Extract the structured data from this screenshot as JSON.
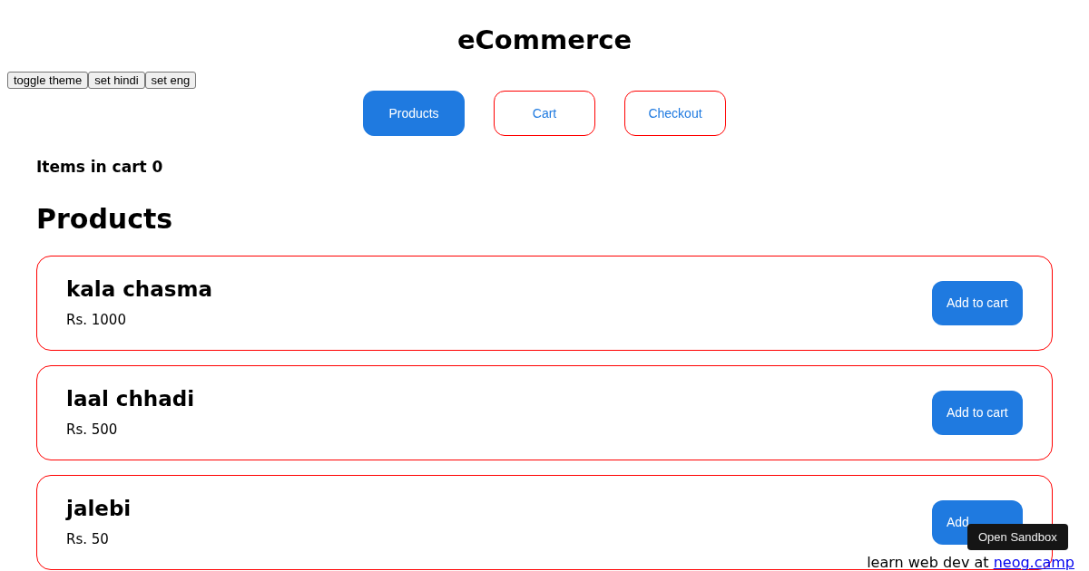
{
  "title": "eCommerce",
  "utility_buttons": [
    "toggle theme",
    "set hindi",
    "set eng"
  ],
  "tabs": [
    {
      "label": "Products",
      "selected": true
    },
    {
      "label": "Cart",
      "selected": false
    },
    {
      "label": "Checkout",
      "selected": false
    }
  ],
  "cart_count": "Items in cart 0",
  "heading": "Products",
  "products": [
    {
      "name": "kala chasma",
      "price": "Rs. 1000",
      "button": "Add to cart"
    },
    {
      "name": "laal chhadi",
      "price": "Rs. 500",
      "button": "Add to cart"
    },
    {
      "name": "jalebi",
      "price": "Rs. 50",
      "button": "Add"
    }
  ],
  "sandbox_button": "Open Sandbox",
  "footer": {
    "text": "learn web dev at",
    "link": "neog.camp"
  }
}
